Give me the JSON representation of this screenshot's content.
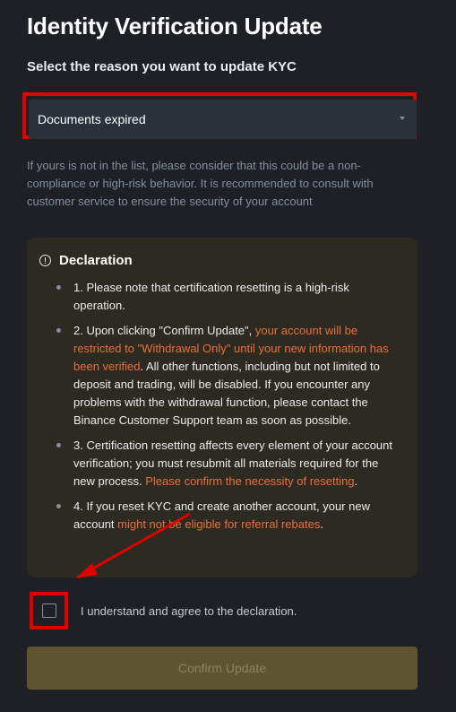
{
  "header": {
    "title": "Identity Verification Update",
    "subtitle": "Select the reason you want to update KYC"
  },
  "reason_select": {
    "value": "Documents expired",
    "icon": "caret-down-icon"
  },
  "hint": "If yours is not in the list, please consider that this could be a non-compliance or high-risk behavior. It is recommended to consult with customer service to ensure the security of your account",
  "declaration": {
    "title": "Declaration",
    "icon": "info-circle-icon",
    "items": [
      {
        "parts": [
          {
            "text": "1. Please note that certification resetting is a high-risk operation.",
            "warn": false
          }
        ]
      },
      {
        "parts": [
          {
            "text": "2. Upon clicking \"Confirm Update\", ",
            "warn": false
          },
          {
            "text": "your account will be restricted to \"Withdrawal Only\" until your new information has been verified",
            "warn": true
          },
          {
            "text": ". All other functions, including but not limited to deposit and trading, will be disabled. If you encounter any problems with the withdrawal function, please contact the Binance Customer Support team as soon as possible.",
            "warn": false
          }
        ]
      },
      {
        "parts": [
          {
            "text": "3. Certification resetting affects every element of your account verification; you must resubmit all materials required for the new process. ",
            "warn": false
          },
          {
            "text": "Please confirm the necessity of resetting",
            "warn": true
          },
          {
            "text": ".",
            "warn": false
          }
        ]
      },
      {
        "parts": [
          {
            "text": "4. If you reset KYC and create another account, your new account ",
            "warn": false
          },
          {
            "text": "might not be eligible for referral rebates",
            "warn": true
          },
          {
            "text": ".",
            "warn": false
          }
        ]
      }
    ]
  },
  "agreement": {
    "label": "I understand and agree to the declaration.",
    "checked": false
  },
  "confirm_button": {
    "label": "Confirm Update"
  },
  "colors": {
    "background": "#1e2026",
    "warning_text": "#e86f3a",
    "highlight_red": "#e00000",
    "declaration_bg": "#2d2b21",
    "button_disabled": "#5e5430"
  }
}
